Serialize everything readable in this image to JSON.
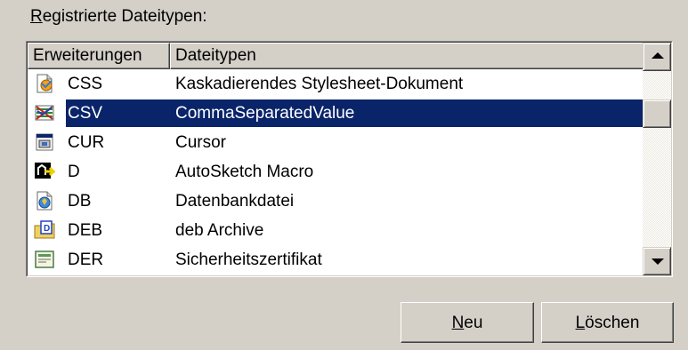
{
  "caption": {
    "accel": "R",
    "rest": "egistrierte Dateitypen:"
  },
  "list": {
    "columns": [
      "Erweiterungen",
      "Dateitypen"
    ],
    "rows": [
      {
        "ext": "CSS",
        "type": "Kaskadierendes Stylesheet-Dokument",
        "icon": "css-document-icon",
        "selected": false
      },
      {
        "ext": "CSV",
        "type": "CommaSeparatedValue",
        "icon": "csv-document-icon",
        "selected": true
      },
      {
        "ext": "CUR",
        "type": "Cursor",
        "icon": "cursor-file-icon",
        "selected": false
      },
      {
        "ext": "D",
        "type": "AutoSketch Macro",
        "icon": "autosketch-macro-icon",
        "selected": false
      },
      {
        "ext": "DB",
        "type": "Datenbankdatei",
        "icon": "database-file-icon",
        "selected": false
      },
      {
        "ext": "DEB",
        "type": "deb Archive",
        "icon": "deb-archive-icon",
        "selected": false
      },
      {
        "ext": "DER",
        "type": "Sicherheitszertifikat",
        "icon": "certificate-icon",
        "selected": false
      }
    ]
  },
  "buttons": {
    "new_accel": "N",
    "new_rest": "eu",
    "delete_accel": "L",
    "delete_rest": "öschen"
  },
  "colors": {
    "selection": "#0a246a",
    "face": "#d4d0c8"
  }
}
